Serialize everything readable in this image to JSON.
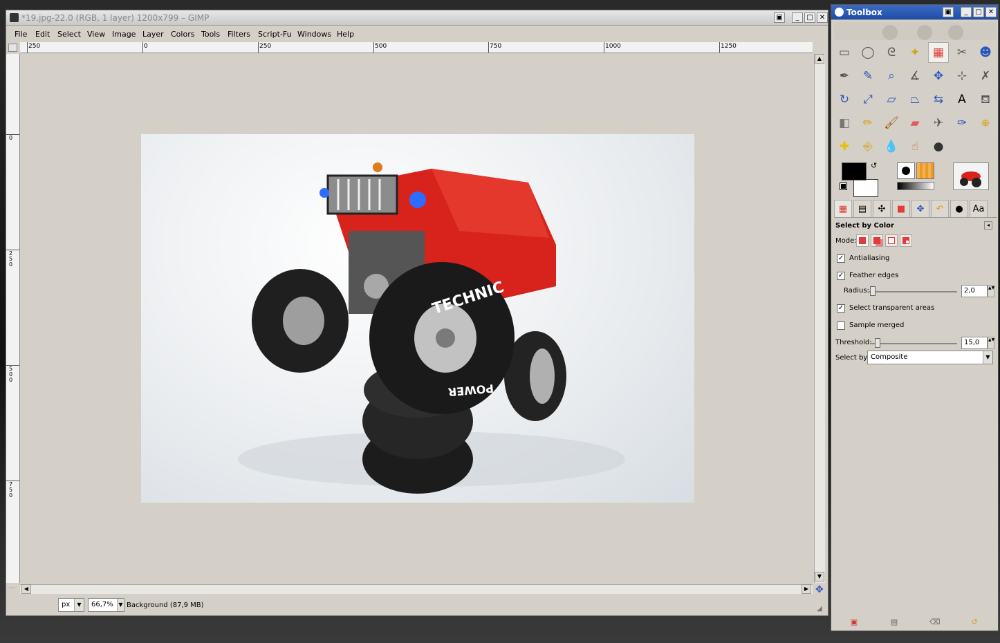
{
  "image_window": {
    "title": "*19.jpg-22.0 (RGB, 1 layer) 1200x799 – GIMP",
    "menu": [
      "File",
      "Edit",
      "Select",
      "View",
      "Image",
      "Layer",
      "Colors",
      "Tools",
      "Filters",
      "Script-Fu",
      "Windows",
      "Help"
    ],
    "hruler_labels": [
      "250",
      "0",
      "250",
      "500",
      "750",
      "1000",
      "1250"
    ],
    "vruler_labels": [
      "0",
      "250",
      "500",
      "750"
    ],
    "unit": "px",
    "zoom": "66,7%",
    "status": "Background (87,9 MB)",
    "photo_text": {
      "sidewall_top": "TECHNIC",
      "sidewall_bottom": "POWER"
    }
  },
  "toolbox": {
    "title": "Toolbox",
    "tools": [
      {
        "name": "rect-select",
        "glyph": "▭"
      },
      {
        "name": "ellipse-select",
        "glyph": "◯"
      },
      {
        "name": "free-select",
        "glyph": "ᘓ"
      },
      {
        "name": "fuzzy-select",
        "glyph": "✦"
      },
      {
        "name": "select-by-color",
        "glyph": "▦"
      },
      {
        "name": "scissors-select",
        "glyph": "✂"
      },
      {
        "name": "foreground-select",
        "glyph": "☻"
      },
      {
        "name": "paths",
        "glyph": "✒"
      },
      {
        "name": "color-picker",
        "glyph": "✎"
      },
      {
        "name": "zoom",
        "glyph": "⌕"
      },
      {
        "name": "measure",
        "glyph": "∡"
      },
      {
        "name": "move",
        "glyph": "✥"
      },
      {
        "name": "align",
        "glyph": "⊹"
      },
      {
        "name": "crop",
        "glyph": "✗"
      },
      {
        "name": "rotate",
        "glyph": "↻"
      },
      {
        "name": "scale",
        "glyph": "⤢"
      },
      {
        "name": "shear",
        "glyph": "▱"
      },
      {
        "name": "perspective",
        "glyph": "⏢"
      },
      {
        "name": "flip",
        "glyph": "⇆"
      },
      {
        "name": "text",
        "glyph": "A"
      },
      {
        "name": "bucket-fill",
        "glyph": "⛾"
      },
      {
        "name": "blend",
        "glyph": "◧"
      },
      {
        "name": "pencil",
        "glyph": "✏"
      },
      {
        "name": "paintbrush",
        "glyph": "🖌"
      },
      {
        "name": "eraser",
        "glyph": "▰"
      },
      {
        "name": "airbrush",
        "glyph": "✈"
      },
      {
        "name": "ink",
        "glyph": "✑"
      },
      {
        "name": "clone",
        "glyph": "⎈"
      },
      {
        "name": "heal",
        "glyph": "✚"
      },
      {
        "name": "perspective-clone",
        "glyph": "⎆"
      },
      {
        "name": "blur-sharpen",
        "glyph": "💧"
      },
      {
        "name": "smudge",
        "glyph": "☝"
      },
      {
        "name": "dodge-burn",
        "glyph": "●"
      }
    ],
    "tabs": [
      "tool-options",
      "device-status",
      "paths",
      "colormap",
      "pointer",
      "undo",
      "brushes",
      "fonts"
    ],
    "fonts_tab_label": "Aa",
    "options": {
      "title": "Select by Color",
      "mode_label": "Mode:",
      "antialiasing": {
        "label": "Antialiasing",
        "checked": true
      },
      "feather": {
        "label": "Feather edges",
        "checked": true
      },
      "radius": {
        "label": "Radius:",
        "value": "2,0",
        "fraction": 0.02
      },
      "transparent": {
        "label": "Select transparent areas",
        "checked": true
      },
      "sample_merged": {
        "label": "Sample merged",
        "checked": false
      },
      "threshold": {
        "label": "Threshold:",
        "value": "15,0",
        "fraction": 0.06
      },
      "select_by": {
        "label": "Select by:",
        "value": "Composite"
      }
    },
    "colors": {
      "foreground": "#000000",
      "background": "#ffffff"
    }
  }
}
